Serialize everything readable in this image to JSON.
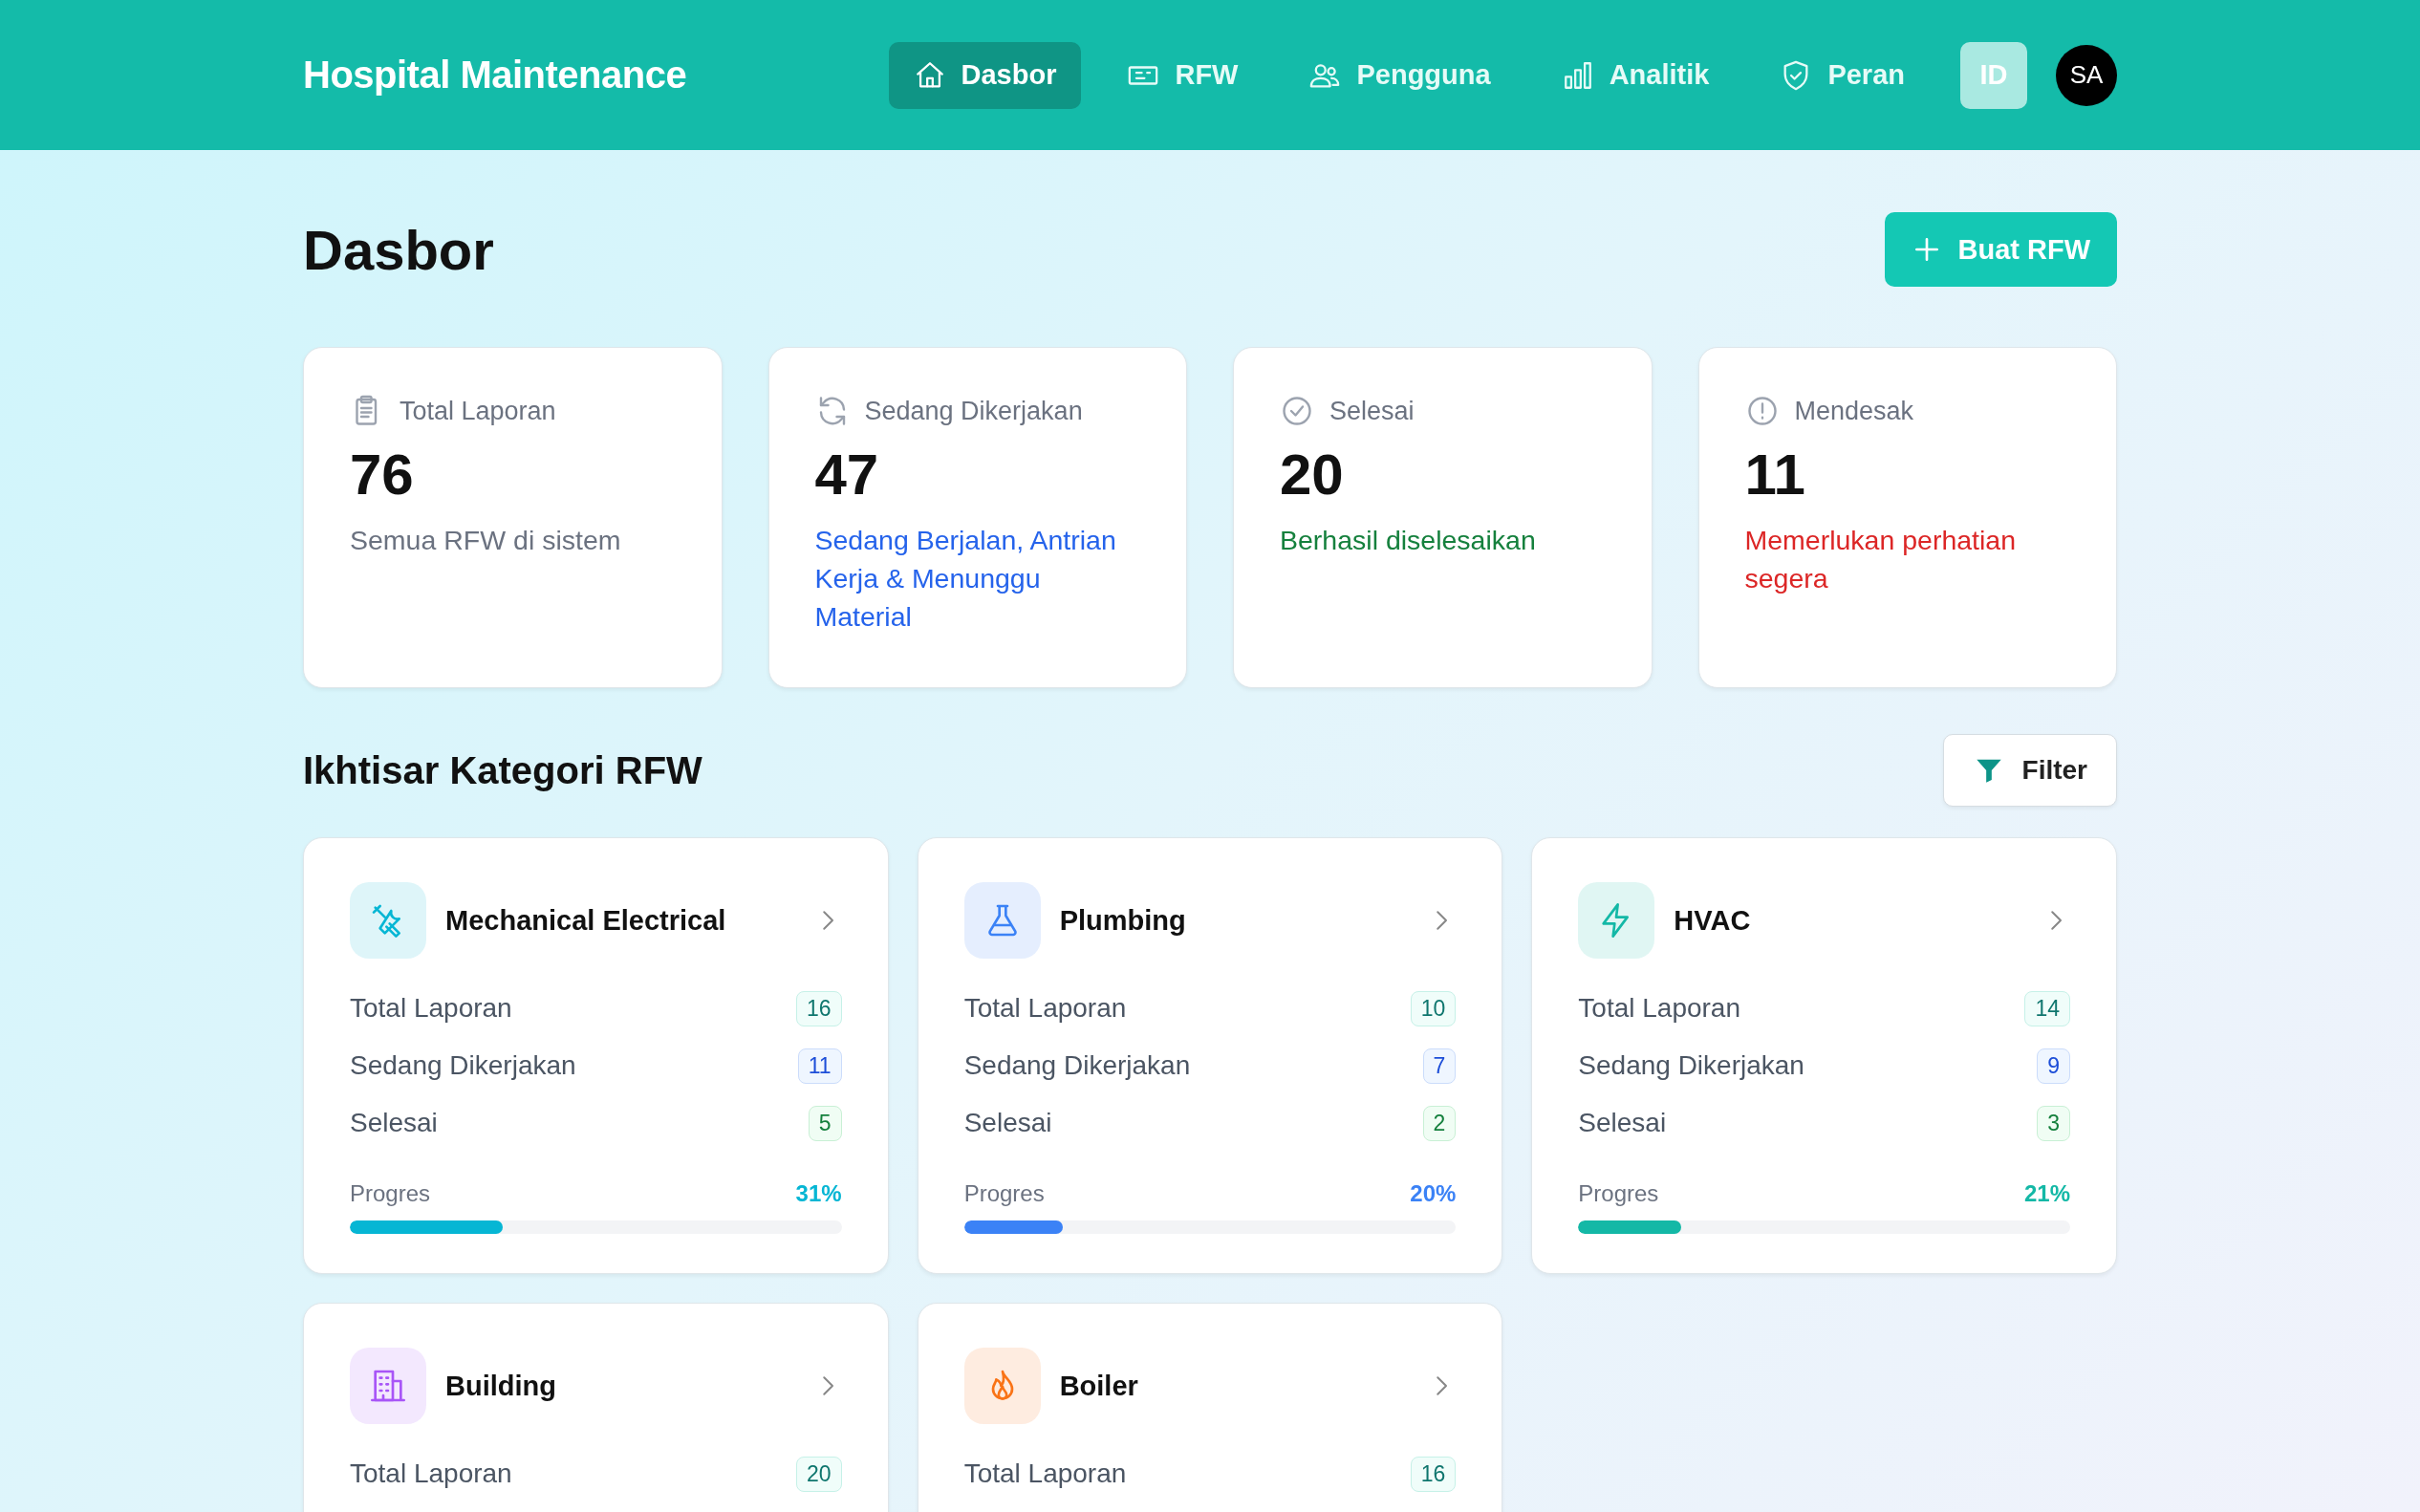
{
  "header": {
    "brand": "Hospital Maintenance",
    "nav": [
      {
        "label": "Dasbor",
        "kind": "home",
        "selected": true
      },
      {
        "label": "RFW",
        "kind": "ticket",
        "selected": false
      },
      {
        "label": "Pengguna",
        "kind": "users",
        "selected": false
      },
      {
        "label": "Analitik",
        "kind": "chart",
        "selected": false
      },
      {
        "label": "Peran",
        "kind": "shield",
        "selected": false
      }
    ],
    "language": "ID",
    "avatar": "SA"
  },
  "page": {
    "title": "Dasbor",
    "create_button": "Buat RFW"
  },
  "stats": [
    {
      "kind": "clipboard",
      "label": "Total Laporan",
      "value": "76",
      "note": "Semua RFW di sistem",
      "color": "#6b7280"
    },
    {
      "kind": "refresh",
      "label": "Sedang Dikerjakan",
      "value": "47",
      "note": "Sedang Berjalan, Antrian Kerja & Menunggu Material",
      "color": "#2563eb"
    },
    {
      "kind": "check",
      "label": "Selesai",
      "value": "20",
      "note": "Berhasil diselesaikan",
      "color": "#15803d"
    },
    {
      "kind": "alert",
      "label": "Mendesak",
      "value": "11",
      "note": "Memerlukan perhatian segera",
      "color": "#dc2626"
    }
  ],
  "overview": {
    "title": "Ikhtisar Kategori RFW",
    "filter_button": "Filter",
    "categories": [
      {
        "kind": "tools",
        "name": "Mechanical Electrical",
        "color": "#06b6d4",
        "rows": [
          {
            "kind": "total",
            "label": "Total Laporan",
            "count": "16"
          },
          {
            "kind": "progress",
            "label": "Sedang Dikerjakan",
            "count": "11"
          },
          {
            "kind": "done",
            "label": "Selesai",
            "count": "5"
          }
        ],
        "progress": {
          "label": "Progres",
          "percent": "31%",
          "level": 0.31
        }
      },
      {
        "kind": "flask",
        "name": "Plumbing",
        "color": "#3b82f6",
        "rows": [
          {
            "kind": "total",
            "label": "Total Laporan",
            "count": "10"
          },
          {
            "kind": "progress",
            "label": "Sedang Dikerjakan",
            "count": "7"
          },
          {
            "kind": "done",
            "label": "Selesai",
            "count": "2"
          }
        ],
        "progress": {
          "label": "Progres",
          "percent": "20%",
          "level": 0.2
        }
      },
      {
        "kind": "bolt",
        "name": "HVAC",
        "color": "#14b8a6",
        "rows": [
          {
            "kind": "total",
            "label": "Total Laporan",
            "count": "14"
          },
          {
            "kind": "progress",
            "label": "Sedang Dikerjakan",
            "count": "9"
          },
          {
            "kind": "done",
            "label": "Selesai",
            "count": "3"
          }
        ],
        "progress": {
          "label": "Progres",
          "percent": "21%",
          "level": 0.21
        }
      },
      {
        "kind": "building",
        "name": "Building",
        "color": "#a855f7",
        "rows": [
          {
            "kind": "total",
            "label": "Total Laporan",
            "count": "20"
          }
        ]
      },
      {
        "kind": "fire",
        "name": "Boiler",
        "color": "#f97316",
        "rows": [
          {
            "kind": "total",
            "label": "Total Laporan",
            "count": "16"
          }
        ]
      }
    ]
  }
}
